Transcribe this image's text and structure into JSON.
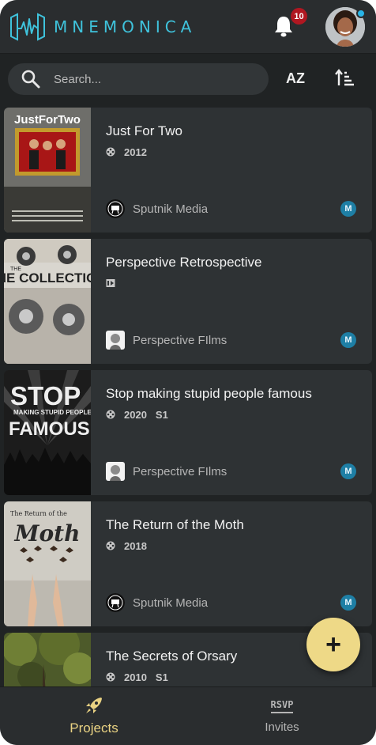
{
  "header": {
    "brand": "MNEMONICA",
    "notification_count": "10",
    "brand_color": "#3fc3dc"
  },
  "search": {
    "placeholder": "Search..."
  },
  "toolbar": {
    "sort_label": "AZ",
    "sort_order_icon": "sort-ascending-icon"
  },
  "projects": [
    {
      "title": "Just For Two",
      "type_icon": "film-reel-icon",
      "year": "2012",
      "season": "",
      "company": "Sputnik Media",
      "member_initial": "M",
      "poster_text": "JustForTwo"
    },
    {
      "title": "Perspective Retrospective",
      "type_icon": "video-series-icon",
      "year": "",
      "season": "",
      "company": "Perspective FIlms",
      "member_initial": "M",
      "poster_text": "THE COLLECTION"
    },
    {
      "title": "Stop making stupid people famous",
      "type_icon": "film-reel-icon",
      "year": "2020",
      "season": "S1",
      "company": "Perspective FIlms",
      "member_initial": "M",
      "poster_text": "STOP"
    },
    {
      "title": "The Return of the Moth",
      "type_icon": "film-reel-icon",
      "year": "2018",
      "season": "",
      "company": "Sputnik Media",
      "member_initial": "M",
      "poster_text": "Moth"
    },
    {
      "title": "The Secrets of Orsary",
      "type_icon": "film-reel-icon",
      "year": "2010",
      "season": "S1",
      "company": "",
      "member_initial": "",
      "poster_text": ""
    }
  ],
  "fab": {
    "label": "+"
  },
  "nav": {
    "projects_label": "Projects",
    "invites_label": "Invites",
    "rsvp_text": "RSVP",
    "active_color": "#ead383"
  }
}
